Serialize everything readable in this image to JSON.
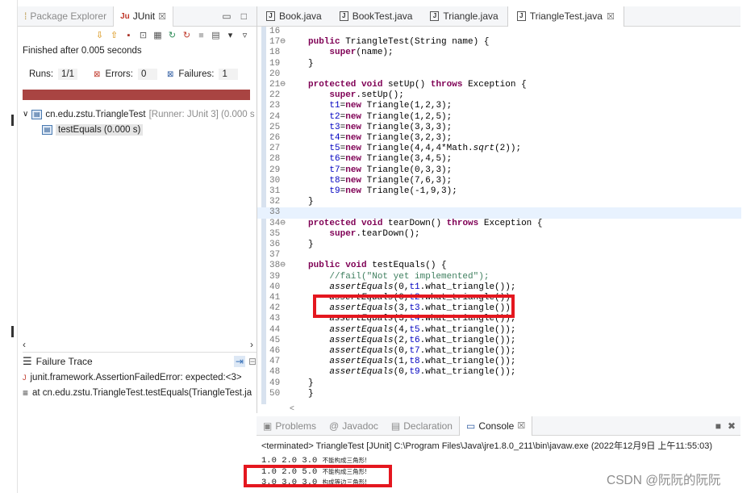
{
  "junit_view": {
    "tabs": [
      {
        "label": "Package Explorer",
        "icon": "package-icon"
      },
      {
        "label": "JUnit",
        "icon": "junit-icon",
        "close": "☒"
      }
    ],
    "status_text": "Finished after 0.005 seconds",
    "runs_label": "Runs:",
    "runs_value": "1/1",
    "errors_label": "Errors:",
    "errors_value": "0",
    "failures_label": "Failures:",
    "failures_value": "1",
    "progress_color": "#a94442",
    "tree": {
      "suite_label": "cn.edu.zstu.TriangleTest",
      "suite_runner": "[Runner: JUnit 3] (0.000 s",
      "test_label": "testEquals (0.000 s)"
    },
    "failure_trace": {
      "title": "Failure Trace",
      "lines": [
        "junit.framework.AssertionFailedError: expected:<3>",
        "at cn.edu.zstu.TriangleTest.testEquals(TriangleTest.ja"
      ]
    }
  },
  "editor": {
    "tabs": [
      "Book.java",
      "BookTest.java",
      "Triangle.java",
      "TriangleTest.java"
    ],
    "active_tab": "TriangleTest.java",
    "tab_close": "☒",
    "lines": [
      {
        "n": "16",
        "text": ""
      },
      {
        "n": "17⊖",
        "text": "    public TriangleTest(String name) {"
      },
      {
        "n": "18",
        "text": "        super(name);"
      },
      {
        "n": "19",
        "text": "    }"
      },
      {
        "n": "20",
        "text": ""
      },
      {
        "n": "21⊖",
        "text": "    protected void setUp() throws Exception {"
      },
      {
        "n": "22",
        "text": "        super.setUp();"
      },
      {
        "n": "23",
        "text": "        t1=new Triangle(1,2,3);"
      },
      {
        "n": "24",
        "text": "        t2=new Triangle(1,2,5);"
      },
      {
        "n": "25",
        "text": "        t3=new Triangle(3,3,3);"
      },
      {
        "n": "26",
        "text": "        t4=new Triangle(3,2,3);"
      },
      {
        "n": "27",
        "text": "        t5=new Triangle(4,4,4*Math.sqrt(2));"
      },
      {
        "n": "28",
        "text": "        t6=new Triangle(3,4,5);"
      },
      {
        "n": "29",
        "text": "        t7=new Triangle(0,3,3);"
      },
      {
        "n": "30",
        "text": "        t8=new Triangle(7,6,3);"
      },
      {
        "n": "31",
        "text": "        t9=new Triangle(-1,9,3);"
      },
      {
        "n": "32",
        "text": "    }"
      },
      {
        "n": "33",
        "text": ""
      },
      {
        "n": "34⊖",
        "text": "    protected void tearDown() throws Exception {"
      },
      {
        "n": "35",
        "text": "        super.tearDown();"
      },
      {
        "n": "36",
        "text": "    }"
      },
      {
        "n": "37",
        "text": ""
      },
      {
        "n": "38⊖",
        "text": "    public void testEquals() {"
      },
      {
        "n": "39",
        "text": "        //fail(\"Not yet implemented\");"
      },
      {
        "n": "40",
        "text": "        assertEquals(0,t1.what_triangle());"
      },
      {
        "n": "41",
        "text": "        assertEquals(0,t2.what_triangle());"
      },
      {
        "n": "42",
        "text": "        assertEquals(3,t3.what_triangle());"
      },
      {
        "n": "43",
        "text": "        assertEquals(3,t4.what_triangle());"
      },
      {
        "n": "44",
        "text": "        assertEquals(4,t5.what_triangle());"
      },
      {
        "n": "45",
        "text": "        assertEquals(2,t6.what_triangle());"
      },
      {
        "n": "46",
        "text": "        assertEquals(0,t7.what_triangle());"
      },
      {
        "n": "47",
        "text": "        assertEquals(1,t8.what_triangle());"
      },
      {
        "n": "48",
        "text": "        assertEquals(0,t9.what_triangle());"
      },
      {
        "n": "49",
        "text": "    }"
      },
      {
        "n": "50",
        "text": "}"
      }
    ],
    "keywords": [
      "public",
      "protected",
      "void",
      "throws",
      "super",
      "new"
    ],
    "fields": [
      "t1",
      "t2",
      "t3",
      "t4",
      "t5",
      "t6",
      "t7",
      "t8",
      "t9"
    ],
    "highlight_line": "33",
    "scroll_arrow": "<"
  },
  "console_view": {
    "tabs": [
      {
        "label": "Problems",
        "icon": "problems-icon"
      },
      {
        "label": "Javadoc",
        "icon": "at-icon"
      },
      {
        "label": "Declaration",
        "icon": "declaration-icon"
      },
      {
        "label": "Console",
        "icon": "console-icon",
        "close": "☒"
      }
    ],
    "active_tab": "Console",
    "terminated": "<terminated> TriangleTest [JUnit] C:\\Program Files\\Java\\jre1.8.0_211\\bin\\javaw.exe (2022年12月9日 上午11:55:03)",
    "output": [
      {
        "nums": "1.0 2.0 3.0",
        "note": "不能构成三角形!"
      },
      {
        "nums": "1.0 2.0 5.0",
        "note": "不能构成三角形!"
      },
      {
        "nums": "3.0 3.0 3.0",
        "note": "构成等边三角形!"
      }
    ]
  },
  "annotations": {
    "box_color": "#e4171f"
  },
  "watermark": "CSDN @阮阮的阮阮"
}
